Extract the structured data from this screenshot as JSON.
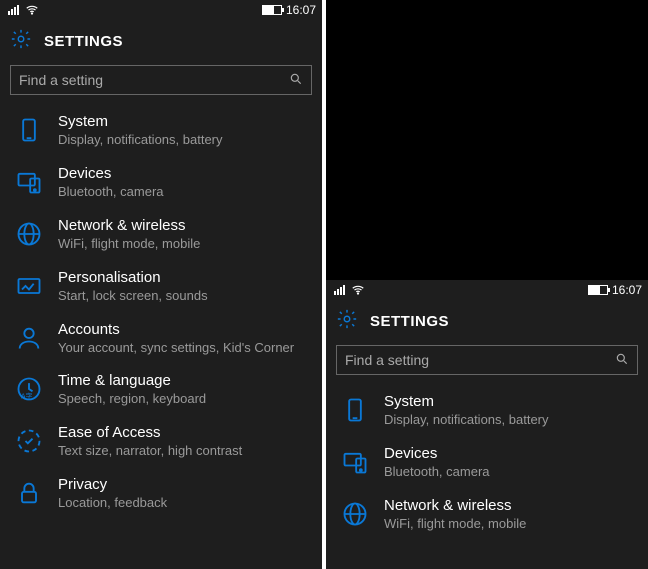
{
  "status": {
    "time": "16:07"
  },
  "header": {
    "title": "SETTINGS"
  },
  "search": {
    "placeholder": "Find a setting"
  },
  "items": [
    {
      "title": "System",
      "sub": "Display, notifications, battery"
    },
    {
      "title": "Devices",
      "sub": "Bluetooth, camera"
    },
    {
      "title": "Network & wireless",
      "sub": "WiFi, flight mode, mobile"
    },
    {
      "title": "Personalisation",
      "sub": "Start, lock screen, sounds"
    },
    {
      "title": "Accounts",
      "sub": "Your account, sync settings, Kid's Corner"
    },
    {
      "title": "Time & language",
      "sub": "Speech, region, keyboard"
    },
    {
      "title": "Ease of Access",
      "sub": "Text size, narrator, high contrast"
    },
    {
      "title": "Privacy",
      "sub": "Location, feedback"
    }
  ],
  "panes": {
    "left": {
      "blackbar_height": 0,
      "visible_items": 8
    },
    "right": {
      "blackbar_height": 280,
      "visible_items": 3
    }
  }
}
